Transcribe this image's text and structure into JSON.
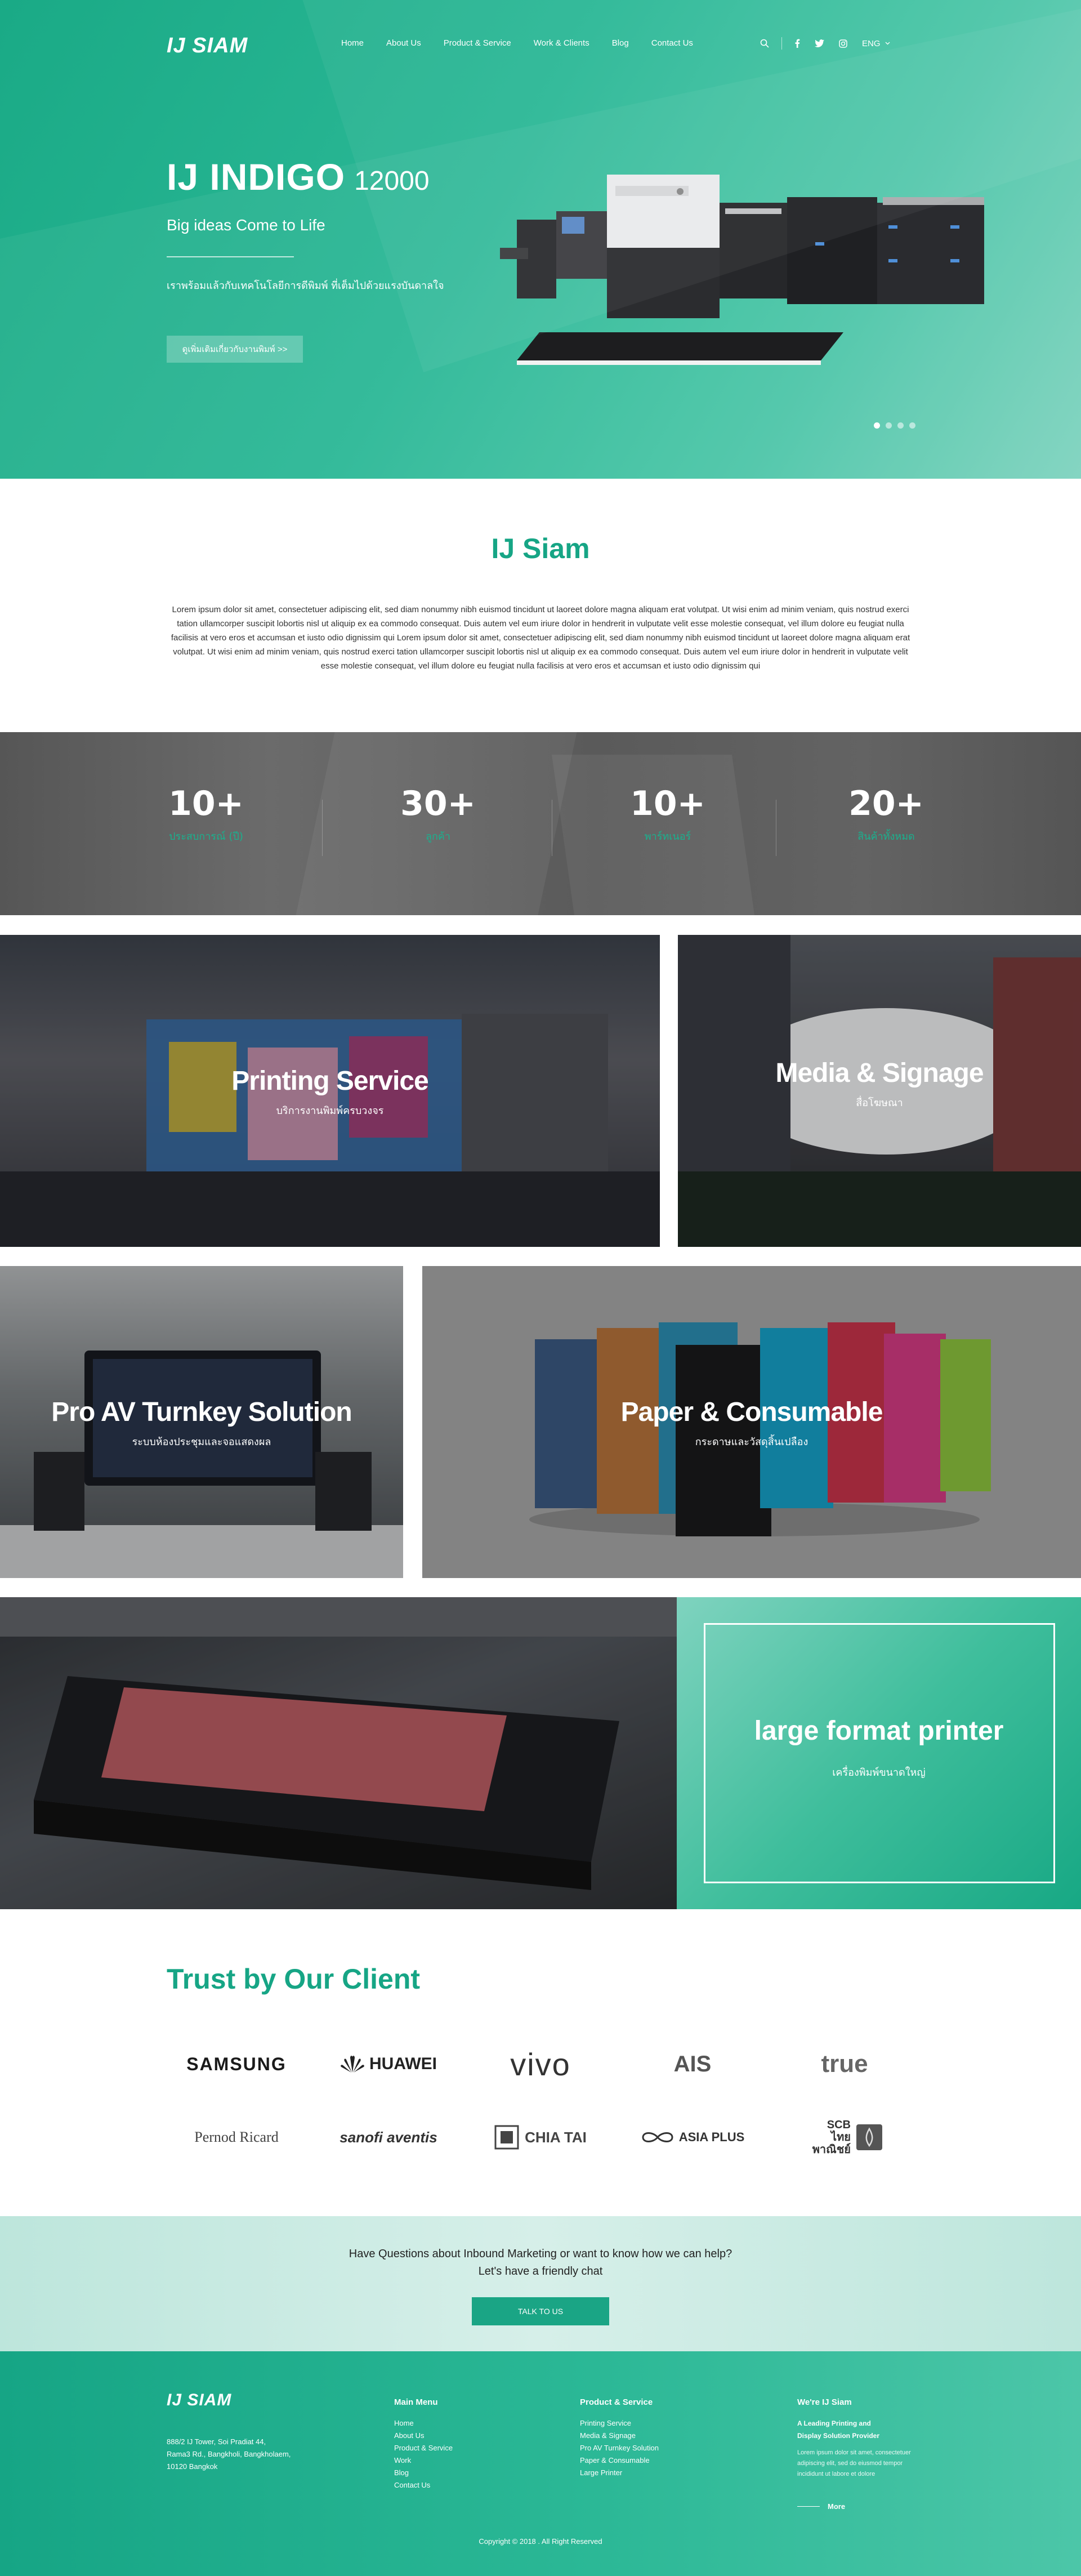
{
  "header": {
    "logo": "IJ SIAM",
    "nav": [
      "Home",
      "About Us",
      "Product & Service",
      "Work & Clients",
      "Blog",
      "Contact Us"
    ],
    "lang": "ENG"
  },
  "hero": {
    "title": "IJ INDIGO",
    "model": "12000",
    "subtitle": "Big ideas Come to Life",
    "description": "เราพร้อมแล้วกับเทคโนโลยีการดีพิมพ์ ที่เต็มไปด้วยแรงบันดาลใจ",
    "button": "ดูเพิ่มเติมเกี่ยวกับงานพิมพ์ >>",
    "slides": 4,
    "active_slide": 1
  },
  "about": {
    "title": "IJ Siam",
    "text": "Lorem ipsum dolor sit amet, consectetuer adipiscing elit, sed diam nonummy nibh euismod tincidunt ut laoreet dolore magna aliquam erat volutpat. Ut wisi enim ad minim veniam, quis nostrud exerci tation ullamcorper suscipit lobortis nisl ut aliquip ex ea commodo consequat. Duis autem vel eum iriure dolor in hendrerit in vulputate velit esse molestie consequat, vel illum dolore eu feugiat nulla facilisis at vero eros et accumsan et iusto odio dignissim qui Lorem ipsum dolor sit amet, consectetuer adipiscing elit, sed diam nonummy nibh euismod tincidunt ut laoreet dolore magna aliquam erat volutpat. Ut wisi enim ad minim veniam, quis nostrud exerci tation ullamcorper suscipit lobortis nisl ut aliquip ex ea commodo consequat. Duis autem vel eum iriure dolor in hendrerit in vulputate velit esse molestie consequat, vel illum dolore eu feugiat nulla facilisis at vero eros et accumsan et iusto odio dignissim qui"
  },
  "stats": [
    {
      "value": "10+",
      "label": "ประสบการณ์ (ปี)"
    },
    {
      "value": "30+",
      "label": "ลูกค้า"
    },
    {
      "value": "10+",
      "label": "พาร์ทเนอร์"
    },
    {
      "value": "20+",
      "label": "สินค้าทั้งหมด"
    }
  ],
  "services": {
    "printing": {
      "title": "Printing Service",
      "subtitle": "บริการงานพิมพ์ครบวงจร"
    },
    "media": {
      "title": "Media & Signage",
      "subtitle": "สื่อโฆษณา"
    },
    "proav": {
      "title": "Pro AV Turnkey Solution",
      "subtitle": "ระบบห้องประชุมและจอแสดงผล"
    },
    "paper": {
      "title": "Paper & Consumable",
      "subtitle": "กระดาษและวัสดุสิ้นเปลือง"
    },
    "large": {
      "title": "large format printer",
      "subtitle": "เครื่องพิมพ์ขนาดใหญ่"
    }
  },
  "clients": {
    "title": "Trust by Our Client",
    "logos": [
      "SAMSUNG",
      "HUAWEI",
      "vivo",
      "AIS",
      "true",
      "Pernod Ricard",
      "sanofi aventis",
      "CHIA TAI",
      "ASIA PLUS",
      "SCB ไทยพาณิชย์"
    ]
  },
  "cta": {
    "line1": "Have Questions about Inbound Marketing or want to know how we can help?",
    "line2": "Let's have a friendly chat",
    "button": "TALK TO US"
  },
  "footer": {
    "logo": "IJ SIAM",
    "address": [
      "888/2 IJ Tower, Soi Pradiat 44,",
      "Rama3 Rd., Bangkholi, Bangkholaem,",
      "10120 Bangkok"
    ],
    "main_menu": {
      "title": "Main Menu",
      "items": [
        "Home",
        "About Us",
        "Product & Service",
        "Work",
        "Blog",
        "Contact Us"
      ]
    },
    "products": {
      "title": "Product & Service",
      "items": [
        "Printing Service",
        "Media & Signage",
        "Pro AV Turnkey Solution",
        "Paper & Consumable",
        "Large Printer"
      ]
    },
    "about": {
      "title": "We're IJ Siam",
      "tagline1": "A Leading Printing and",
      "tagline2": "Display Solution Provider",
      "text": "Lorem ipsum dolor sit amet, consectetuer adipiscing elit, sed do eiusmod tempor incididunt ut labore et dolore"
    },
    "more": "More",
    "copyright": "Copyright © 2018 . All Right Reserved"
  },
  "colors": {
    "brand": "#1aa585",
    "brand_light": "#4cc6a8",
    "text": "#333333"
  }
}
